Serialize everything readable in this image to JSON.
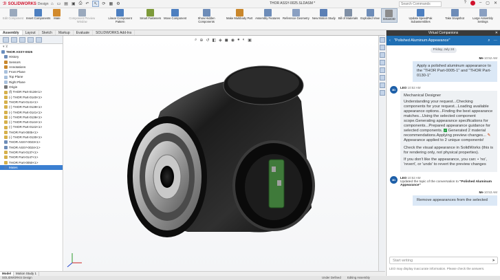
{
  "app": {
    "brand": "SOLIDWORKS",
    "brand_sub": "Design",
    "document_title": "THOR ASSY-0025.SLDASM *",
    "search_placeholder": "Search Commands"
  },
  "ribbon": {
    "buttons": [
      {
        "label": "Edit Component",
        "dim": true
      },
      {
        "label": "Insert Components"
      },
      {
        "label": "Mate"
      },
      {
        "label": "Component Preview Window",
        "dim": true
      },
      {
        "label": "Linear Component Pattern"
      },
      {
        "label": "Smart Fasteners"
      },
      {
        "label": "Move Component"
      },
      {
        "label": "Show Hidden Components"
      },
      {
        "label": "Make Multibody Part"
      },
      {
        "label": "Assembly Features"
      },
      {
        "label": "Reference Geometry"
      },
      {
        "label": "New Motion Study"
      },
      {
        "label": "Bill of Materials"
      },
      {
        "label": "Exploded View"
      },
      {
        "label": "Instant3D",
        "active": true
      },
      {
        "label": "Update SpeedPak Subassemblies"
      },
      {
        "label": "Take Snapshot"
      },
      {
        "label": "Large Assembly Settings"
      }
    ]
  },
  "tabs": [
    "Assembly",
    "Layout",
    "Sketch",
    "Markup",
    "Evaluate",
    "SOLIDWORKS Add-Ins"
  ],
  "tree": {
    "root": "THOR ASSY-0025",
    "items": [
      "History",
      "Sensors",
      "Annotations",
      "Front Plane",
      "Top Plane",
      "Right Plane",
      "Origin",
      "(f) THOR Part-0136<1>",
      "(-) THOR Part-0140<1>",
      "THOR Part-0141<1>",
      "(-) THOR Part-0139<1>",
      "(-) THOR Part-0141<1>",
      "(-) THOR Part-0136<1>",
      "(-) THOR Part-0144<1>",
      "(-) THOR Part-0142<1>",
      "THOR Part-0005<1>",
      "(-) THOR Part-0130<1>",
      "THOR ASSY-0023<1>",
      "THOR ASSY-0024<1>",
      "THOR Part-0137<1>",
      "THOR Part-0147<1>",
      "THOR Part-0050<1>",
      "Mates"
    ]
  },
  "bottom_tabs": [
    "Model",
    "Motion Study 1"
  ],
  "status": {
    "left": "SOLIDWORKS Design",
    "mid1": "Under Defined",
    "mid2": "Editing Assembly"
  },
  "chat": {
    "panel_title": "Virtual Companions",
    "header_title": "\"Polished Aluminum Appearance\"",
    "date": "Friday, July 24",
    "me_name": "Me",
    "me_time": "10:52 AM",
    "me_message": "Apply a polished aluminum appearance to the \"THOR Part-0005-1\" and \"THOR Part-0130-1\"",
    "leo_name": "LEO",
    "leo_time": "10:52 AM",
    "leo_role": "Mechanical Designer",
    "leo_p1": "Understanding your request...Checking components for your request...Loading available appearance options...Finding the best appearance matches...Using the selected component scope.Generating appearance specifications for components...Prepared appearance guidance for selected components.",
    "leo_p1b": "Generated 2 material recommendations.Applying preview changes...",
    "leo_p1c": "Appearance applied to 2 unique components!",
    "leo_p2": "Check the visual appearance in SolidWorks (this is for rendering only, not physical properties).",
    "leo_p3": "If you don't like the appearance, you can: • 'no', 'revert', or 'undo' to revert the preview changes",
    "leo2_time": "10:52 AM",
    "leo2_text": "Updated the topic of the conversation to",
    "leo2_topic": "\"Polished Aluminum Appearance\"",
    "me2_time": "10:53 AM",
    "me2_message": "Remove appearances from the selected",
    "input_placeholder": "Start writing",
    "note": "LEO may display inaccurate information. Please check the answers."
  }
}
